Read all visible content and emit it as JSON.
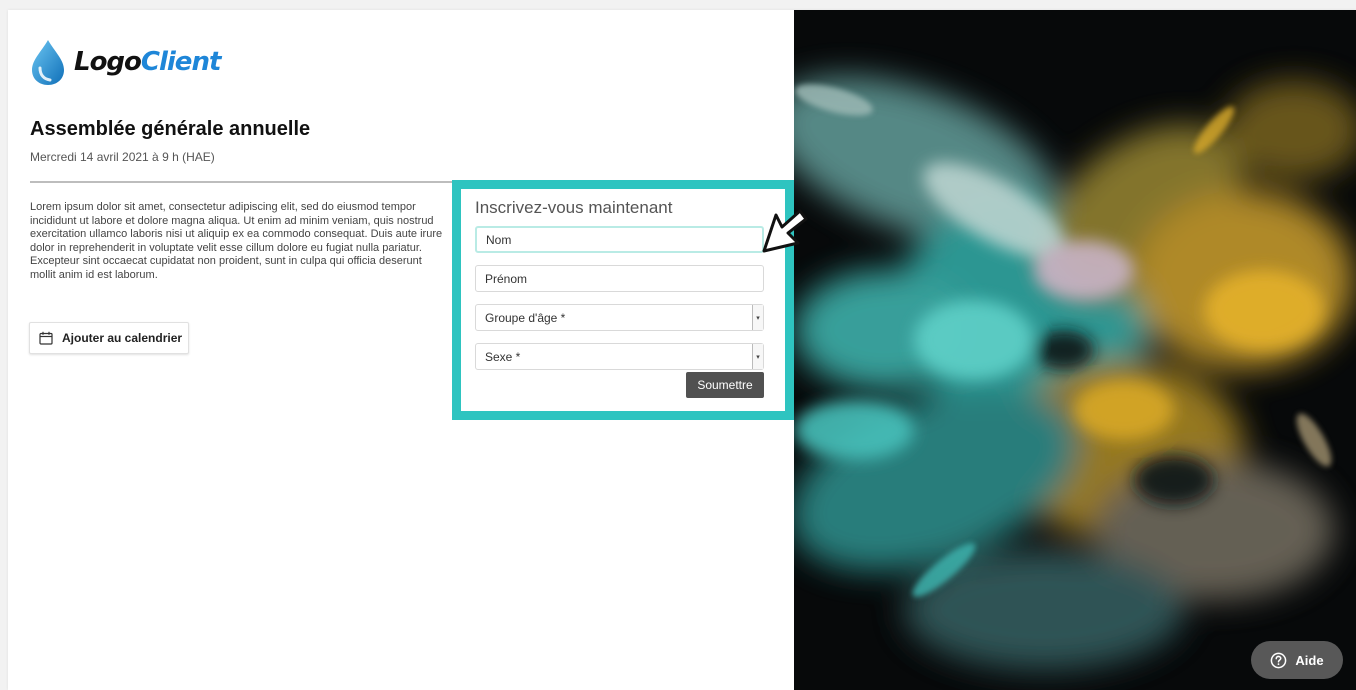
{
  "brand": {
    "logo_part1": "Logo",
    "logo_part2": "Client"
  },
  "event": {
    "title": "Assemblée générale annuelle",
    "date": "Mercredi 14 avril 2021 à 9 h (HAE)",
    "description": "Lorem ipsum dolor sit amet, consectetur adipiscing elit, sed do eiusmod tempor incididunt ut labore et dolore magna aliqua. Ut enim ad minim veniam, quis nostrud exercitation ullamco laboris nisi ut aliquip ex ea commodo consequat. Duis aute irure dolor in reprehenderit in voluptate velit esse cillum dolore eu fugiat nulla pariatur. Excepteur sint occaecat cupidatat non proident, sunt in culpa qui officia deserunt mollit anim id est laborum.",
    "calendar_button": "Ajouter au calendrier"
  },
  "form": {
    "heading": "Inscrivez-vous maintenant",
    "last_name_placeholder": "Nom",
    "first_name_placeholder": "Prénom",
    "age_group_label": "Groupe d'âge *",
    "sex_label": "Sexe *",
    "submit_label": "Soumettre"
  },
  "help": {
    "label": "Aide"
  },
  "colors": {
    "accent_teal": "#2ec4c0",
    "brand_blue": "#1e86d8",
    "submit_bg": "#515151"
  },
  "icons": [
    "water-drop-logo-icon",
    "calendar-icon",
    "cursor-arrow-icon",
    "help-circle-icon",
    "dropdown-arrow-icon"
  ]
}
